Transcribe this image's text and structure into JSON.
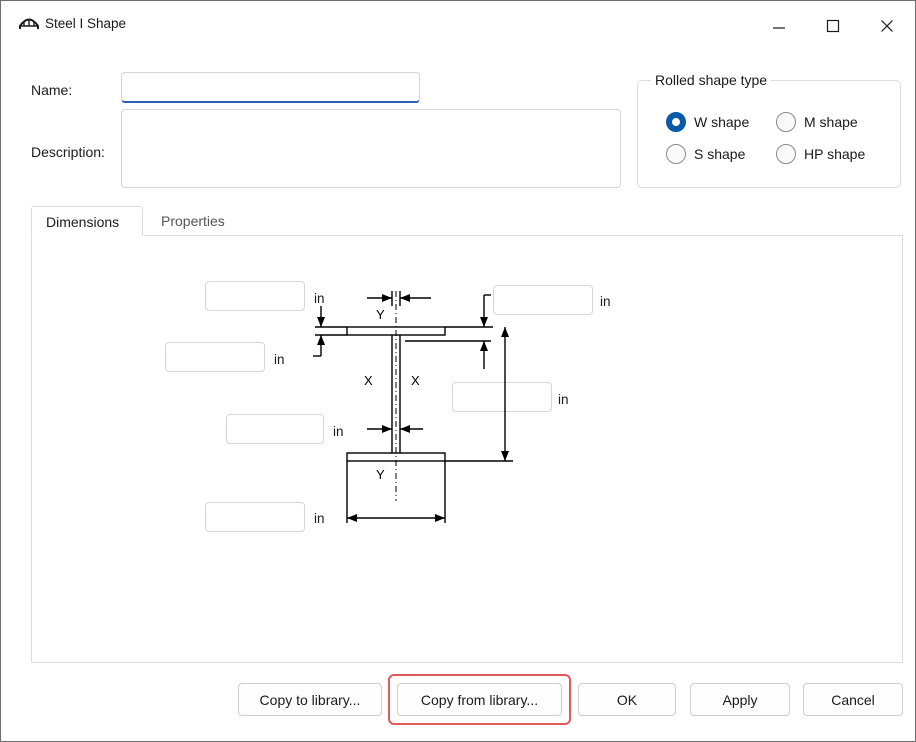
{
  "window": {
    "title": "Steel I Shape",
    "app_icon": "bridge-icon",
    "controls": {
      "minimize": "minimize-icon",
      "maximize": "maximize-icon",
      "close": "close-icon"
    }
  },
  "form": {
    "name_label": "Name:",
    "name_value": "",
    "description_label": "Description:",
    "description_value": ""
  },
  "rolled_shape_type": {
    "title": "Rolled shape type",
    "options": [
      {
        "label": "W shape",
        "checked": true
      },
      {
        "label": "M shape",
        "checked": false
      },
      {
        "label": "S shape",
        "checked": false
      },
      {
        "label": "HP shape",
        "checked": false
      }
    ]
  },
  "tabs": [
    {
      "label": "Dimensions",
      "active": true
    },
    {
      "label": "Properties",
      "active": false
    }
  ],
  "dimensions": {
    "unit": "in",
    "top_flange_width": "",
    "top_flange_thickness": "",
    "web_thickness": "",
    "bottom_flange_width": "",
    "top_gap": "",
    "depth": "",
    "axis_labels": {
      "y_top": "Y",
      "y_bottom": "Y",
      "x_left": "X",
      "x_right": "X"
    }
  },
  "buttons": {
    "copy_to_library": "Copy to library...",
    "copy_from_library": "Copy from library...",
    "ok": "OK",
    "apply": "Apply",
    "cancel": "Cancel"
  },
  "colors": {
    "accent": "#0a5aa8",
    "focus_underline": "#2f5fb3",
    "highlight": "#e05a5a"
  }
}
